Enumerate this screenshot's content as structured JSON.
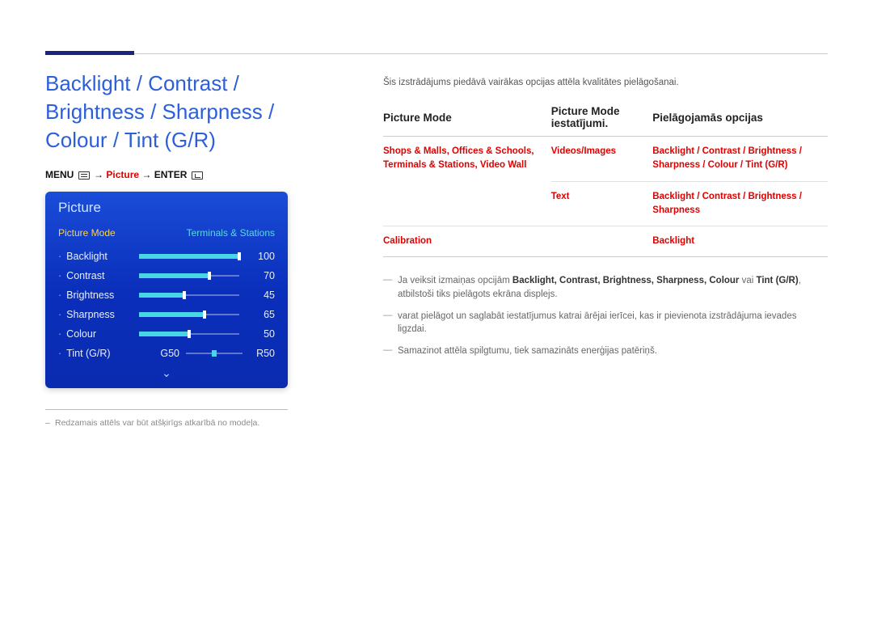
{
  "title": "Backlight / Contrast / Brightness / Sharpness / Colour / Tint (G/R)",
  "menu_path": {
    "menu": "MENU",
    "arrow": "→",
    "picture": "Picture",
    "enter": "ENTER"
  },
  "tv_panel": {
    "header": "Picture",
    "mode_label": "Picture Mode",
    "mode_value": "Terminals & Stations",
    "sliders": [
      {
        "label": "Backlight",
        "value": 100,
        "pct": 100
      },
      {
        "label": "Contrast",
        "value": 70,
        "pct": 70
      },
      {
        "label": "Brightness",
        "value": 45,
        "pct": 45
      },
      {
        "label": "Sharpness",
        "value": 65,
        "pct": 65
      },
      {
        "label": "Colour",
        "value": 50,
        "pct": 50
      }
    ],
    "tint": {
      "label": "Tint (G/R)",
      "g": "G50",
      "r": "R50"
    }
  },
  "footnote": "Redzamais attēls var būt atšķirīgs atkarībā no modeļa.",
  "intro": "Šis izstrādājums piedāvā vairākas opcijas attēla kvalitātes pielāgošanai.",
  "table": {
    "headers": {
      "col1": "Picture Mode",
      "col2": "Picture Mode iestatījumi.",
      "col3": "Pielāgojamās opcijas"
    },
    "rows": [
      {
        "c1": "Shops & Malls, Offices & Schools, Terminals & Stations, Video Wall",
        "c2": "Videos/Images",
        "c3": "Backlight / Contrast / Brightness / Sharpness / Colour / Tint (G/R)"
      },
      {
        "c1": "",
        "c2": "Text",
        "c3": "Backlight / Contrast / Brightness / Sharpness"
      },
      {
        "c1": "Calibration",
        "c2": "",
        "c3": "Backlight"
      }
    ]
  },
  "notes": {
    "n1_pre": "Ja veiksit izmaiņas opcijām ",
    "n1_b": "Backlight, Contrast, Brightness, Sharpness, Colour",
    "n1_mid": " vai ",
    "n1_b2": "Tint (G/R)",
    "n1_post": ", atbilstoši tiks pielāgots ekrāna displejs.",
    "n2": "varat pielāgot un saglabāt iestatījumus katrai ārējai ierīcei, kas ir pievienota izstrādājuma ievades ligzdai.",
    "n3": "Samazinot attēla spilgtumu, tiek samazināts enerģijas patēriņš."
  }
}
